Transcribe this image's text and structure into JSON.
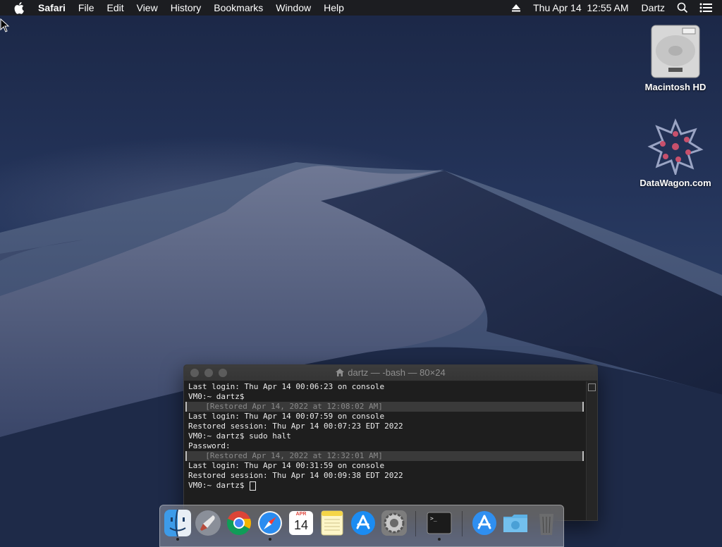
{
  "menubar": {
    "app_name": "Safari",
    "menus": [
      "File",
      "Edit",
      "View",
      "History",
      "Bookmarks",
      "Window",
      "Help"
    ],
    "datetime": "Thu Apr 14  12:55 AM",
    "user": "Dartz"
  },
  "desktop": {
    "icons": [
      {
        "label": "Macintosh HD",
        "icon": "hard-drive-icon"
      },
      {
        "label": "DataWagon.com",
        "icon": "datawagon-logo-icon"
      }
    ]
  },
  "terminal": {
    "title": "dartz — -bash — 80×24",
    "lines": [
      "Last login: Thu Apr 14 00:06:23 on console",
      "VM0:~ dartz$",
      "  [Restored Apr 14, 2022 at 12:08:02 AM]",
      "Last login: Thu Apr 14 00:07:59 on console",
      "Restored session: Thu Apr 14 00:07:23 EDT 2022",
      "VM0:~ dartz$ sudo halt",
      "Password:",
      "  [Restored Apr 14, 2022 at 12:32:01 AM]",
      "Last login: Thu Apr 14 00:31:59 on console",
      "Restored session: Thu Apr 14 00:09:38 EDT 2022",
      "VM0:~ dartz$ "
    ]
  },
  "dock": {
    "apps": [
      {
        "name": "Finder",
        "icon": "finder-icon",
        "running": true
      },
      {
        "name": "Launchpad",
        "icon": "launchpad-icon",
        "running": false
      },
      {
        "name": "Google Chrome",
        "icon": "chrome-icon",
        "running": false
      },
      {
        "name": "Safari",
        "icon": "safari-icon",
        "running": true
      },
      {
        "name": "Calendar",
        "icon": "calendar-icon",
        "running": false,
        "month": "APR",
        "day": "14"
      },
      {
        "name": "Notes",
        "icon": "notes-icon",
        "running": false
      },
      {
        "name": "App Store",
        "icon": "app-store-icon",
        "running": false
      },
      {
        "name": "System Preferences",
        "icon": "system-preferences-icon",
        "running": false
      },
      {
        "name": "Terminal",
        "icon": "terminal-icon",
        "running": true
      },
      {
        "name": "Applications",
        "icon": "applications-folder-icon",
        "running": false
      },
      {
        "name": "Downloads",
        "icon": "downloads-folder-icon",
        "running": false
      },
      {
        "name": "Trash",
        "icon": "trash-icon",
        "running": false
      }
    ]
  },
  "colors": {
    "menubar_bg": "#1c1c1e",
    "terminal_bg": "#1e1e1e",
    "terminal_text": "#ececec",
    "restored_text": "#8a8a8a"
  }
}
